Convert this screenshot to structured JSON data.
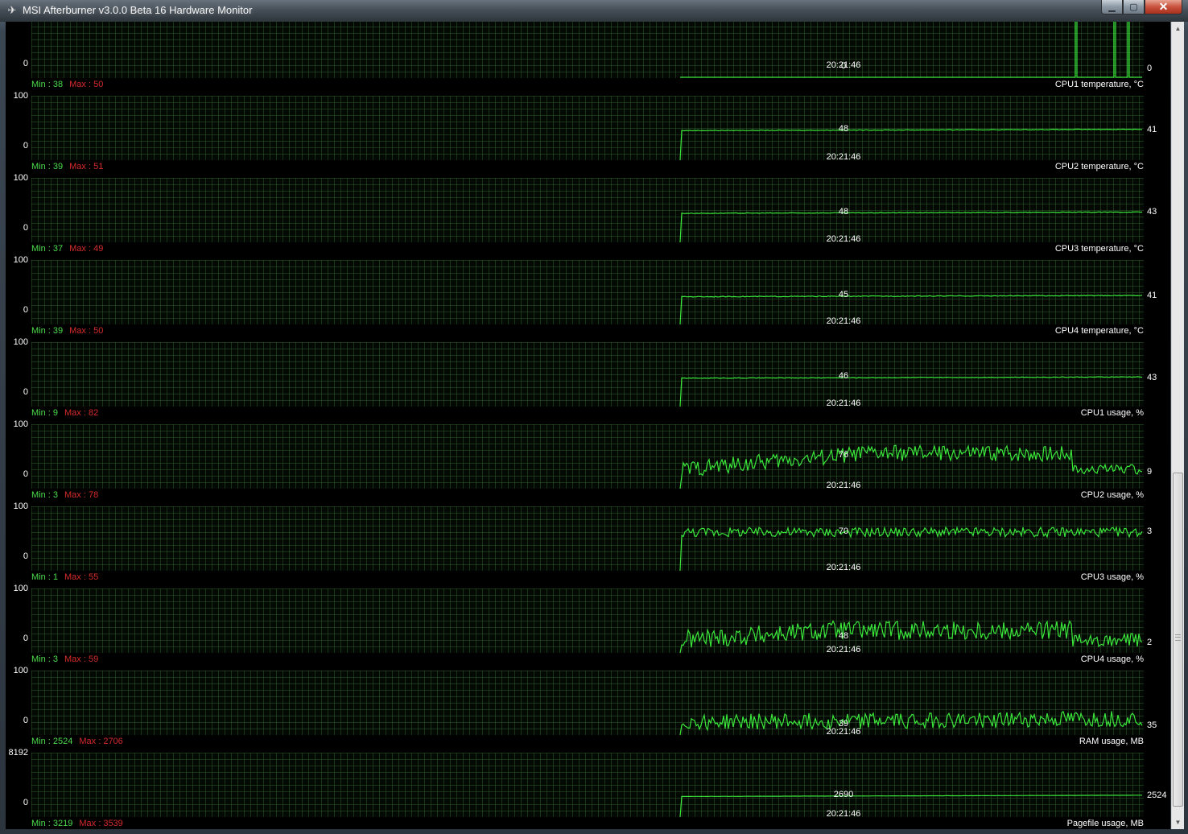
{
  "window": {
    "title": "MSI Afterburner v3.0.0 Beta 16 Hardware Monitor",
    "buttons": {
      "minimize_icon": "minimize-icon",
      "maximize_icon": "maximize-icon",
      "close_icon": "close-icon"
    }
  },
  "colors": {
    "background": "#000000",
    "grid": "#1f3f1f",
    "line": "#3ae83a",
    "min_label": "#4cdc4c",
    "max_label": "#d62b2b",
    "text": "#ffffff"
  },
  "graphs": [
    {
      "id": "top",
      "ymax": "",
      "ymin": "0",
      "current": "0",
      "peak": "0",
      "timestamp": "20:21:46",
      "min": "Min : 38",
      "max": "Max : 50",
      "name": "CPU1 temperature, °C",
      "kind": "spikes",
      "level": 0.0
    },
    {
      "id": "cpu1temp",
      "ymax": "100",
      "ymin": "0",
      "current": "41",
      "peak": "48",
      "timestamp": "20:21:46",
      "min": "Min : 39",
      "max": "Max : 51",
      "name": "CPU2 temperature, °C",
      "kind": "flat",
      "level": 0.46,
      "noise": 0.01
    },
    {
      "id": "cpu2temp",
      "ymax": "100",
      "ymin": "0",
      "current": "43",
      "peak": "48",
      "timestamp": "20:21:46",
      "min": "Min : 37",
      "max": "Max : 49",
      "name": "CPU3 temperature, °C",
      "kind": "flat",
      "level": 0.45,
      "noise": 0.01
    },
    {
      "id": "cpu3temp",
      "ymax": "100",
      "ymin": "0",
      "current": "41",
      "peak": "45",
      "timestamp": "20:21:46",
      "min": "Min : 39",
      "max": "Max : 50",
      "name": "CPU4 temperature, °C",
      "kind": "flat",
      "level": 0.43,
      "noise": 0.012
    },
    {
      "id": "cpu4temp",
      "ymax": "100",
      "ymin": "0",
      "current": "43",
      "peak": "46",
      "timestamp": "20:21:46",
      "min": "Min : 9",
      "max": "Max : 82",
      "name": "CPU1 usage, %",
      "kind": "flat",
      "level": 0.44,
      "noise": 0.01
    },
    {
      "id": "cpu1usage",
      "ymax": "100",
      "ymin": "0",
      "current": "9",
      "peak": "76",
      "timestamp": "20:21:46",
      "min": "Min : 3",
      "max": "Max : 78",
      "name": "CPU2 usage, %",
      "kind": "usage1"
    },
    {
      "id": "cpu2usage",
      "ymax": "100",
      "ymin": "0",
      "current": "3",
      "peak": "70",
      "timestamp": "20:21:46",
      "min": "Min : 1",
      "max": "Max : 55",
      "name": "CPU3 usage, %",
      "kind": "usage2"
    },
    {
      "id": "cpu3usage",
      "ymax": "100",
      "ymin": "0",
      "current": "2",
      "peak": "48",
      "timestamp": "20:21:46",
      "min": "Min : 3",
      "max": "Max : 59",
      "name": "CPU4 usage, %",
      "kind": "usage3"
    },
    {
      "id": "cpu4usage",
      "ymax": "100",
      "ymin": "0",
      "current": "35",
      "peak": "39",
      "timestamp": "20:21:46",
      "min": "Min : 2524",
      "max": "Max : 2706",
      "name": "RAM usage, MB",
      "kind": "usage4"
    },
    {
      "id": "ram",
      "ymax": "8192",
      "ymin": "0",
      "current": "2524",
      "peak": "2690",
      "timestamp": "20:21:46",
      "min": "Min : 3219",
      "max": "Max : 3539",
      "name": "Pagefile usage, MB",
      "kind": "flat",
      "level": 0.32,
      "noise": 0.002
    }
  ]
}
